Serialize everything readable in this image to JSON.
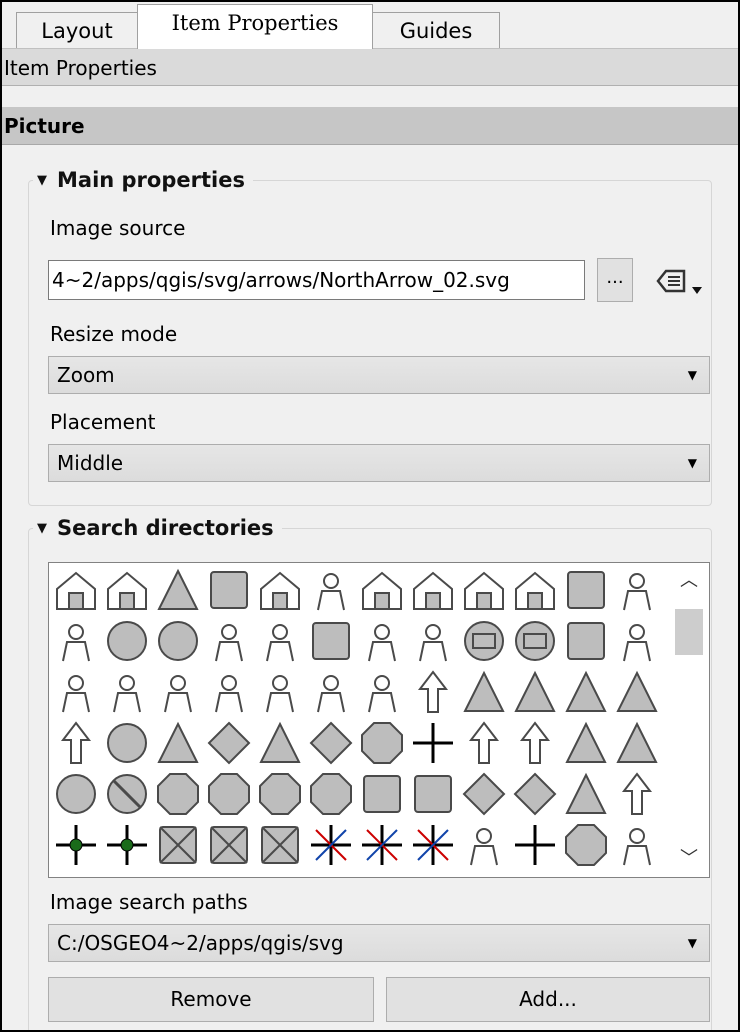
{
  "tabs": [
    {
      "label": "Layout",
      "active": false
    },
    {
      "label": "Item Properties",
      "active": true
    },
    {
      "label": "Guides",
      "active": false
    }
  ],
  "panel_title": "Item Properties",
  "section_title": "Picture",
  "main_properties": {
    "title": "Main properties",
    "image_source_label": "Image source",
    "image_source_value": "4~2/apps/qgis/svg/arrows/NorthArrow_02.svg",
    "browse_button": "...",
    "resize_mode_label": "Resize mode",
    "resize_mode_value": "Zoom",
    "placement_label": "Placement",
    "placement_value": "Middle"
  },
  "search_directories": {
    "title": "Search directories",
    "svg_icons": [
      "hut",
      "house-b",
      "tent",
      "caravan",
      "bed-house",
      "bed",
      "house",
      "shelter",
      "shelter",
      "tree-house",
      "bench",
      "balance",
      "fire",
      "fire-station",
      "fire-station",
      "fountain",
      "info",
      "book",
      "handcuffs",
      "police",
      "mail",
      "mail",
      "phone-box",
      "recycle",
      "tripod",
      "phone",
      "toilets",
      "wheelchair",
      "wc-man",
      "wc-woman",
      "toilet-child",
      "arrow-up",
      "arrow-n",
      "arrow-n",
      "arrow-n",
      "arrow-n",
      "arrow",
      "power",
      "north",
      "compass",
      "north",
      "compass-rose",
      "star",
      "pin",
      "pointer",
      "pointer",
      "north-arrow",
      "north-arrow",
      "circle",
      "no-entry",
      "octagon",
      "badge",
      "shield",
      "star8",
      "square",
      "square",
      "diamond",
      "diamond",
      "triangle",
      "chevron",
      "crossing",
      "crossing",
      "x-box",
      "x-box",
      "x-box",
      "asterisk",
      "asterisk",
      "asterisk",
      "flame",
      "plus",
      "shield",
      "glass"
    ],
    "search_paths_label": "Image search paths",
    "search_path_value": "C:/OSGEO4~2/apps/qgis/svg",
    "remove_button": "Remove",
    "add_button": "Add..."
  },
  "colors": {
    "accent": "#0a64a0",
    "icon_fill": "#bdbdbd",
    "icon_stroke": "#4a4a4a"
  }
}
